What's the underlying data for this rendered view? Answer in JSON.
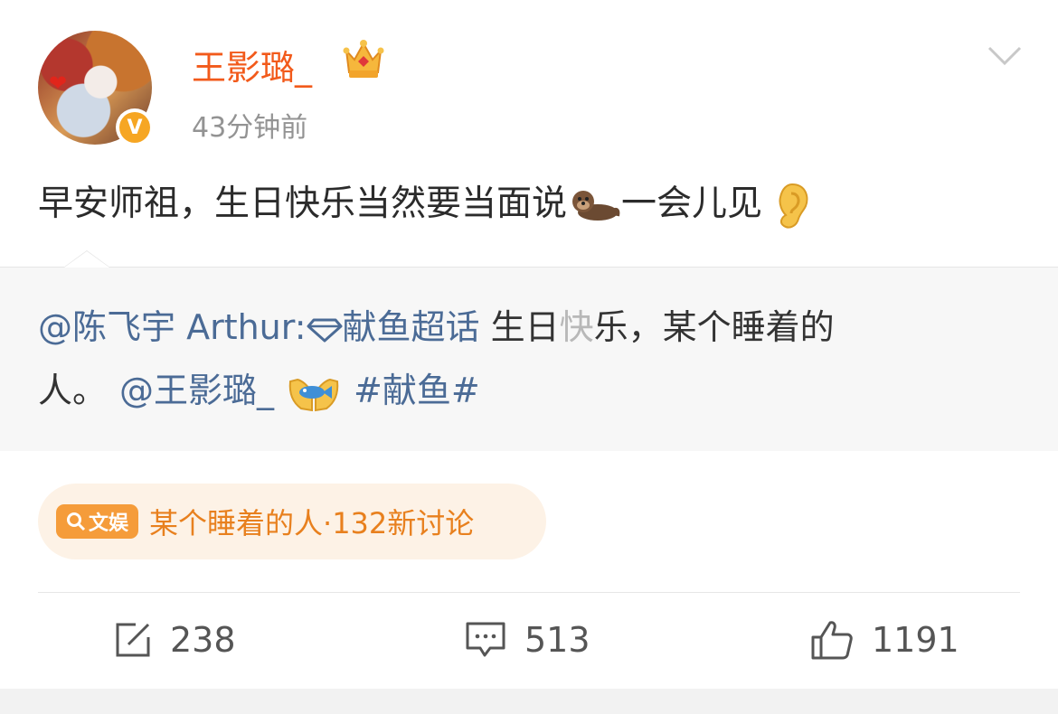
{
  "post": {
    "author": {
      "name": "王影璐_",
      "time": "43分钟前",
      "verified_badge": "V",
      "accent_color": "#f25a1b"
    },
    "text": {
      "part1": "早安师祖，生日快乐当然要当面说",
      "emoji1": "otter",
      "part2": "一会儿见",
      "emoji2": "ear"
    },
    "quote": {
      "mention": "@陈飞宇 Arthur:",
      "topic": "献鱼超话",
      "text_a": " 生日",
      "text_blurred": "快",
      "text_b": "乐，某个睡着的",
      "line2_text": "人。",
      "mention2": "@王影璐_",
      "emoji": "palms-up-with-fish",
      "hashtag": "#献鱼#"
    },
    "topic_pill": {
      "tag": "文娱",
      "text": "某个睡着的人·132新讨论"
    },
    "actions": {
      "repost_count": "238",
      "comment_count": "513",
      "like_count": "1191"
    }
  }
}
